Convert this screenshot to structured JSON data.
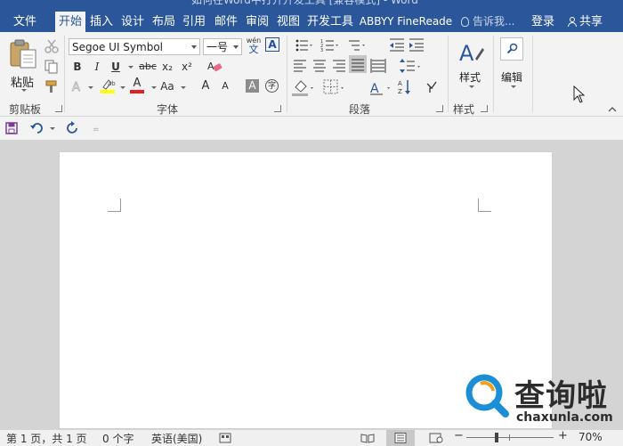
{
  "window_title": "如何在Word中打开开发工具 [兼容模式] - Word",
  "tabs": {
    "file": "文件",
    "home": "开始",
    "insert": "插入",
    "design": "设计",
    "layout": "布局",
    "references": "引用",
    "mailings": "邮件",
    "review": "审阅",
    "view": "视图",
    "developer": "开发工具",
    "abbyy": "ABBYY FineReade"
  },
  "tell_me": "告诉我...",
  "login": "登录",
  "share": "共享",
  "ribbon": {
    "clipboard": {
      "paste": "粘贴",
      "label": "剪贴板"
    },
    "font": {
      "font_name": "Segoe UI Symbol",
      "font_size": "一号",
      "label": "字体",
      "bold": "B",
      "italic": "I",
      "underline": "U",
      "strike": "abc",
      "subscript": "x₂",
      "superscript": "x²",
      "font_color": "A",
      "change_case": "Aa",
      "grow": "A",
      "shrink": "A",
      "char_shade": "A",
      "enclose": "字",
      "wen": "wén",
      "wen_char": "文"
    },
    "paragraph": {
      "label": "段落"
    },
    "styles": {
      "button": "样式",
      "label": "样式"
    },
    "editing": {
      "button": "编辑"
    }
  },
  "status": {
    "page": "第 1 页，共 1 页",
    "words": "0 个字",
    "language": "英语(美国)",
    "zoom": "70%"
  },
  "watermark": {
    "text": "查询啦",
    "url": "chaxunla.com"
  },
  "colors": {
    "accent": "#2b579a",
    "highlight": "#ffff00",
    "font_red": "#e81e1e",
    "watermark_blue": "#1a8fd6"
  }
}
